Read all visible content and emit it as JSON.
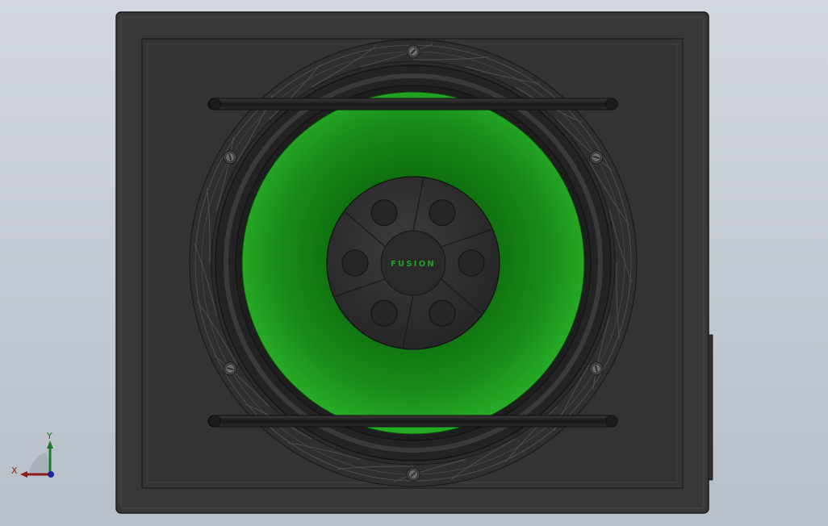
{
  "model": {
    "brand_logo": "FUSION",
    "colors": {
      "background_top": "#d3d8e0",
      "background_bottom": "#b9bfc9",
      "box": "#3a3a3a",
      "cone": "#1f9a1f",
      "rubber": "#262626",
      "logo_text": "#1fa41f"
    }
  },
  "triad": {
    "x_label": "X",
    "y_label": "Y",
    "colors": {
      "x": "#8b1a1a",
      "y": "#1d7a2a",
      "z": "#1a2a9a"
    }
  }
}
